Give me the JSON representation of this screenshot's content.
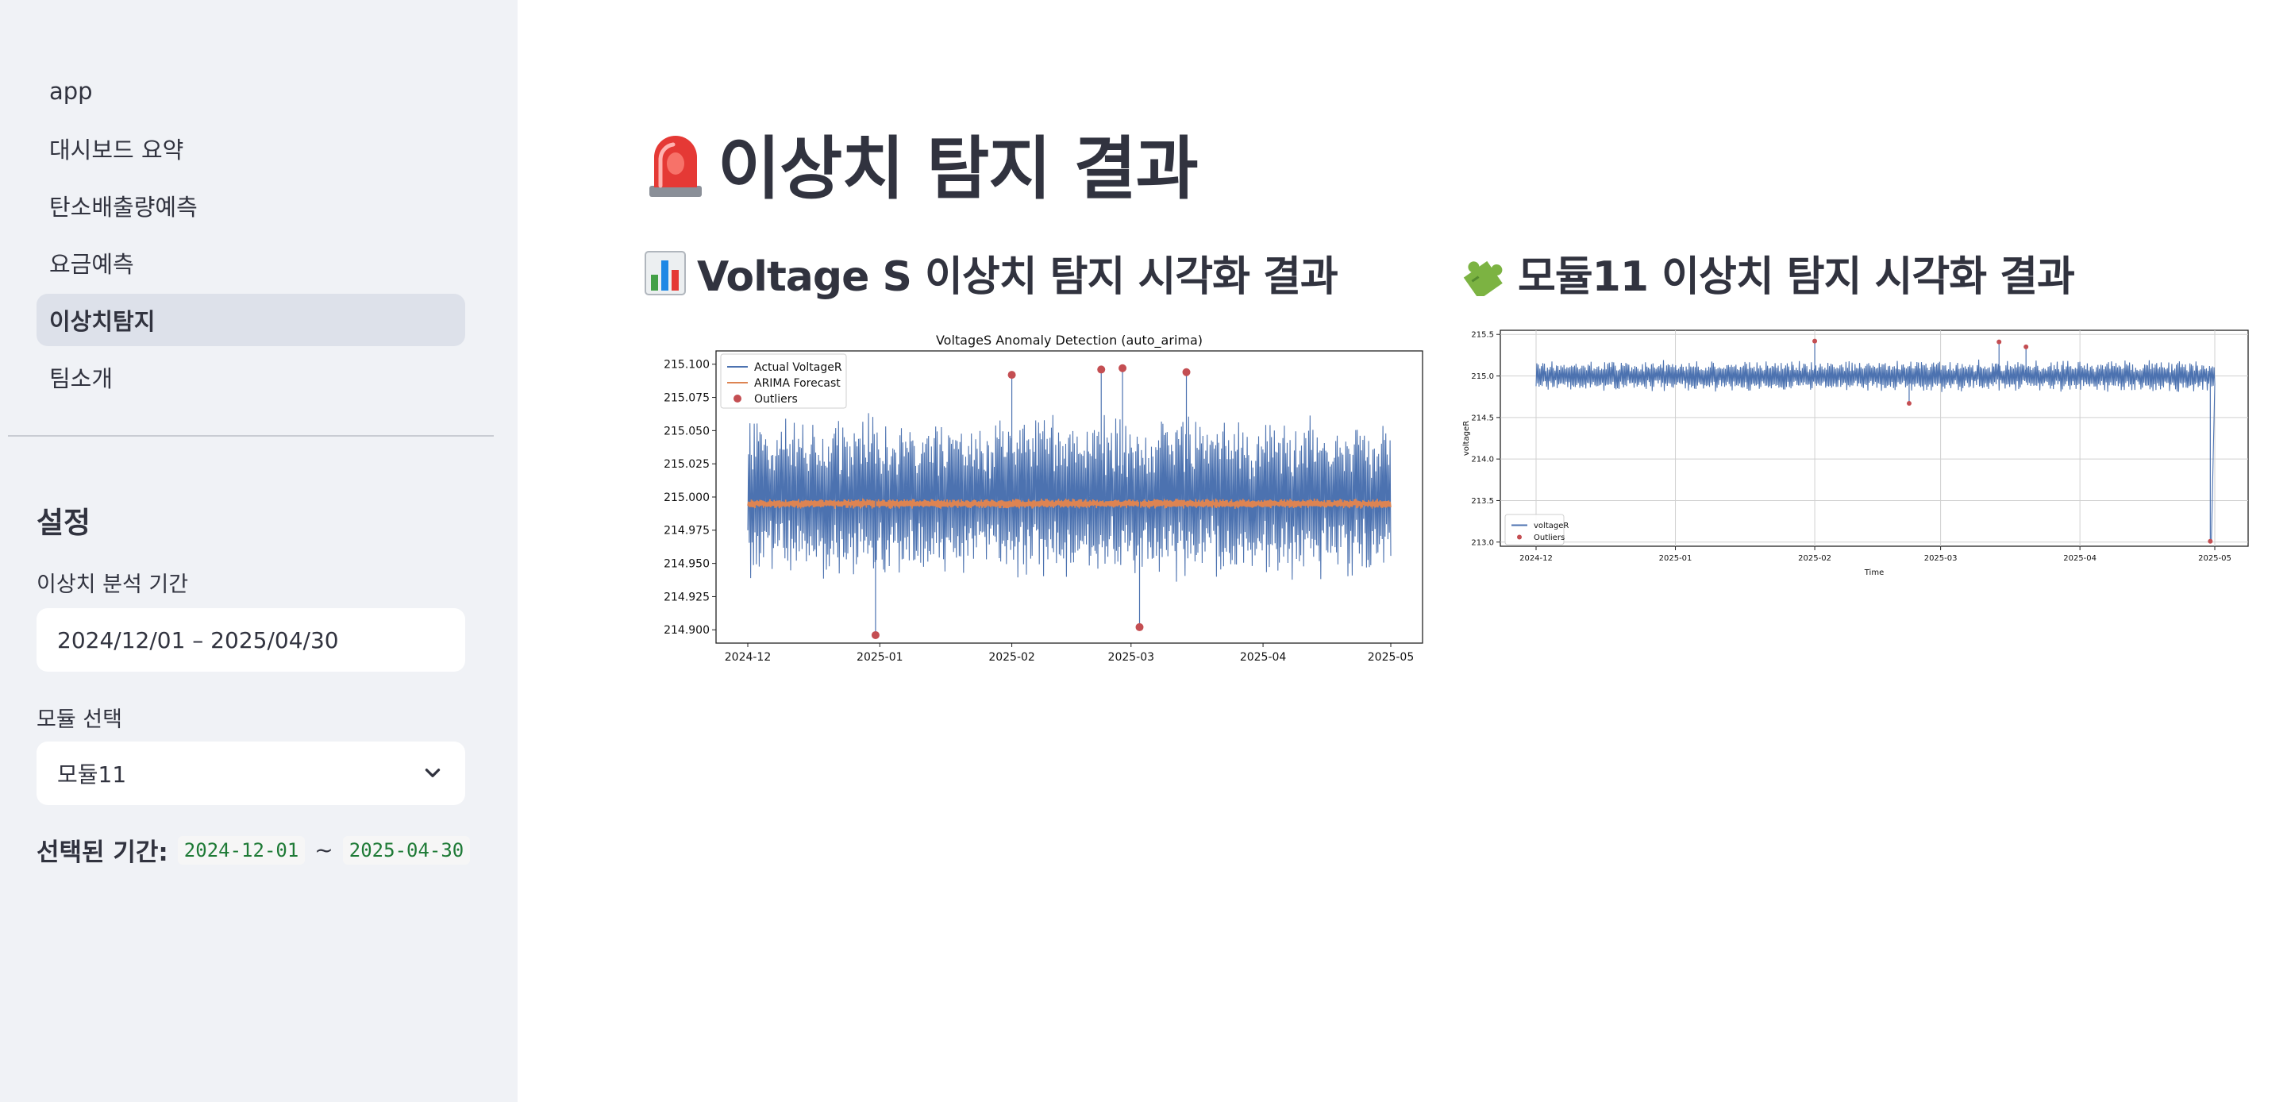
{
  "sidebar": {
    "nav": [
      {
        "label": "app",
        "active": false
      },
      {
        "label": "대시보드 요약",
        "active": false
      },
      {
        "label": "탄소배출량예측",
        "active": false
      },
      {
        "label": "요금예측",
        "active": false
      },
      {
        "label": "이상치탐지",
        "active": true
      },
      {
        "label": "팀소개",
        "active": false
      }
    ],
    "settings_title": "설정",
    "period_label": "이상치 분석 기간",
    "period_value": "2024/12/01 – 2025/04/30",
    "module_label": "모듈 선택",
    "module_value": "모듈11",
    "selected_label": "선택된 기간:",
    "selected_start": "2024-12-01",
    "selected_sep": "~",
    "selected_end": "2025-04-30"
  },
  "main": {
    "title": "이상치 탐지 결과",
    "title_icon": "siren-icon",
    "left_heading": "Voltage S 이상치 탐지 시각화 결과",
    "left_icon": "bar-chart-icon",
    "right_heading": "모듈11 이상치 탐지 시각화 결과",
    "right_icon": "puzzle-icon"
  },
  "colors": {
    "accent_nav_active": "#dde1ea",
    "series_blue": "#4c72b0",
    "forecast_orange": "#dd8452",
    "outlier_red": "#c44e52",
    "code_green": "#1e7a36"
  },
  "chart_data": [
    {
      "type": "line",
      "title": "VoltageS Anomaly Detection (auto_arima)",
      "xlabel": "",
      "ylabel": "",
      "x_ticks": [
        "2024-12",
        "2025-01",
        "2025-02",
        "2025-03",
        "2025-04",
        "2025-05"
      ],
      "y_ticks": [
        "215.100",
        "215.075",
        "215.050",
        "215.025",
        "215.000",
        "214.975",
        "214.950",
        "214.925",
        "214.900"
      ],
      "ylim": [
        214.89,
        215.11
      ],
      "grid": false,
      "legend_position": "top-left",
      "series": [
        {
          "name": "Actual VoltageR",
          "kind": "line",
          "level": 215.0,
          "amplitude": 0.065
        },
        {
          "name": "ARIMA Forecast",
          "kind": "line",
          "level": 214.995,
          "amplitude": 0.004
        },
        {
          "name": "Outliers",
          "kind": "scatter",
          "points": [
            {
              "x": "2024-12-31",
              "y": 214.896
            },
            {
              "x": "2025-02-01",
              "y": 215.092
            },
            {
              "x": "2025-02-22",
              "y": 215.096
            },
            {
              "x": "2025-02-27",
              "y": 215.097
            },
            {
              "x": "2025-03-03",
              "y": 214.902
            },
            {
              "x": "2025-03-14",
              "y": 215.094
            }
          ]
        }
      ]
    },
    {
      "type": "line",
      "title": "",
      "xlabel": "Time",
      "ylabel": "voltageR",
      "x_ticks": [
        "2024-12",
        "2025-01",
        "2025-02",
        "2025-03",
        "2025-04",
        "2025-05"
      ],
      "y_ticks": [
        "215.5",
        "215.0",
        "214.5",
        "214.0",
        "213.5",
        "213.0"
      ],
      "ylim": [
        212.95,
        215.55
      ],
      "grid": true,
      "legend_position": "bottom-left",
      "series": [
        {
          "name": "voltageR",
          "kind": "line",
          "level": 215.0,
          "amplitude": 0.2
        },
        {
          "name": "Outliers",
          "kind": "scatter",
          "points": [
            {
              "x": "2025-02-01",
              "y": 215.42
            },
            {
              "x": "2025-02-22",
              "y": 214.67
            },
            {
              "x": "2025-03-14",
              "y": 215.41
            },
            {
              "x": "2025-03-20",
              "y": 215.35
            },
            {
              "x": "2025-04-30",
              "y": 213.01
            }
          ]
        }
      ]
    }
  ]
}
